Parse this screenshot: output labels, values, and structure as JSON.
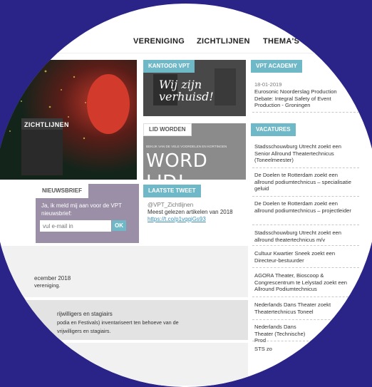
{
  "nav": {
    "items": [
      "VERENIGING",
      "ZICHTLIJNEN",
      "THEMA'S"
    ]
  },
  "hero": {
    "magazine_title": "ZICHTLIJNEN"
  },
  "kantoor": {
    "tag": "KANTOOR VPT",
    "image_text": "Wij zijn verhuisd!"
  },
  "lid": {
    "tag": "LID WORDEN",
    "small": "BEKIJK VAN DE VELE VOORDELEN EN KORTINGEN",
    "big": "WORD LID!"
  },
  "tweet": {
    "tag": "LAATSTE TWEET",
    "handle": "@VPT_Zichtlijnen",
    "text": "Meest gelezen artikelen van 2018",
    "link": "https://t.co/p1vqqiGs93"
  },
  "newsletter": {
    "tab": "NIEUWSBRIEF",
    "message": "Ja, ik meld mij aan voor de VPT nieuwsbrief:",
    "placeholder": "vul e-mail in",
    "button": "OK"
  },
  "academy": {
    "tag": "VPT ACADEMY",
    "date": "18-01-2019",
    "title": "Eurosonic Noorderslag Production Debate: Integral Safety of Event Production - Groningen"
  },
  "vacatures": {
    "tag": "VACATURES",
    "items": [
      "Stadsschouwburg Utrecht zoekt een Senior Allround Theatertechnicus (Toneelmeester)",
      "De Doelen te Rotterdam zoekt een allround podiumtechnicus – specialisatie geluid",
      "De Doelen te Rotterdam zoekt een allround podiumtechnicus – projectleider",
      "Stadsschouwburg Utrecht zoekt een allround theatertechnicus m/v",
      "Cultuur Kwartier Sneek zoekt een Directeur-bestuurder",
      "AGORA Theater, Bioscoop & Congrescentrum te Lelystad zoekt een Allround Podiumtechnicus",
      "Nederlands Dans Theater zoekt Theatertechnicus Toneel",
      "Nederlands Dans Theater (Technische) Prod",
      "STS zo"
    ]
  },
  "news": {
    "item1_line1": "ecember 2018",
    "item1_line2": "vereniging.",
    "item2_line1": "rijwilligers en stagiairs",
    "item2_line2": "podia en Festivals) inventariseert ten behoeve van de",
    "item2_line3": "vrijwilligers en stagiairs."
  }
}
